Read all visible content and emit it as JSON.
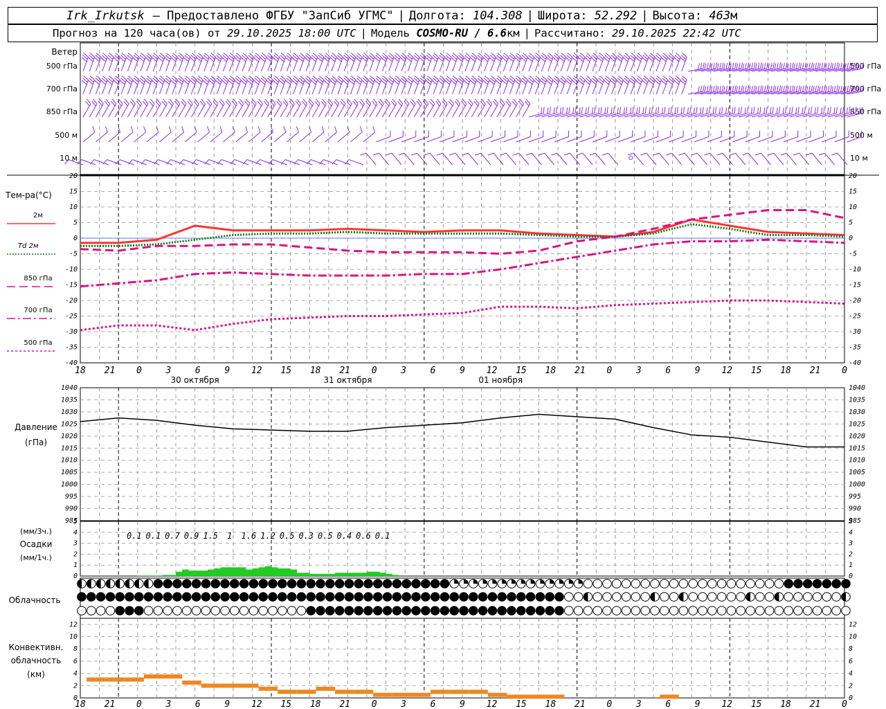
{
  "header": {
    "station": "Irk_Irkutsk",
    "provider": "— Предоставлено ФГБУ \"ЗапСиб УГМС\"",
    "lon_label": "Долгота:",
    "lon": "104.308",
    "lat_label": "Широта:",
    "lat": "52.292",
    "alt_label": "Высота:",
    "alt": "463",
    "alt_unit": "м",
    "forecast_label": "Прогноз на 120 часа(ов) от",
    "forecast_start": "29.10.2025 18:00 UTC",
    "model_label": "Модель",
    "model": "COSMO-RU / 6.6",
    "model_unit": "км",
    "calc_label": "Рассчитано:",
    "calc_time": "29.10.2025 22:42 UTC"
  },
  "wind_panel": {
    "title": "Ветер",
    "levels": [
      "500 гПа",
      "700 гПа",
      "850 гПа",
      "500 м",
      "10 м"
    ],
    "right_levels": [
      "500 гПа",
      "700 гПа",
      "850 гПа",
      "500 м",
      "10 м"
    ]
  },
  "temp_panel": {
    "title": "Тем-ра(°C)",
    "legend": [
      {
        "label": "2м",
        "color": "#ff3333",
        "style": "solid"
      },
      {
        "label": "Td 2м",
        "color": "#117711",
        "style": "dotted"
      },
      {
        "label": "850 гПа",
        "color": "#dd1188",
        "style": "dash"
      },
      {
        "label": "700 гПа",
        "color": "#dd1188",
        "style": "dashdot"
      },
      {
        "label": "500 гПа",
        "color": "#dd1188",
        "style": "dot"
      }
    ],
    "yticks": [
      "20",
      "15",
      "10",
      "5",
      "0",
      "-5",
      "-10",
      "-15",
      "-20",
      "-25",
      "-30",
      "-35",
      "-40"
    ]
  },
  "time_axis": {
    "hours": [
      "18",
      "21",
      "0",
      "3",
      "6",
      "9",
      "12",
      "15",
      "18",
      "21",
      "0",
      "3",
      "6",
      "9",
      "12",
      "15",
      "18",
      "21",
      "0",
      "3",
      "6",
      "9",
      "12",
      "15",
      "18",
      "21",
      "0"
    ],
    "dates": [
      "30 октября",
      "31 октября",
      "01 ноября"
    ]
  },
  "pressure_panel": {
    "title": "Давление",
    "unit": "(гПа)",
    "yticks": [
      "1040",
      "1035",
      "1030",
      "1025",
      "1020",
      "1015",
      "1010",
      "1005",
      "1000",
      "995",
      "990",
      "985"
    ]
  },
  "precip_panel": {
    "unit3h": "(мм/3ч.)",
    "title": "Осадки",
    "unit1h": "(мм/1ч.)",
    "yticks": [
      "5",
      "4",
      "3",
      "2",
      "1",
      "0"
    ],
    "totals": [
      "0.1",
      "0.1",
      "0.7",
      "0.9",
      "1.5",
      "1",
      "1.6",
      "1.2",
      "0.5",
      "0.3",
      "0.5",
      "0.4",
      "0.6",
      "0.1"
    ]
  },
  "cloud_panel": {
    "title": "Облачность"
  },
  "conv_panel": {
    "title1": "Конвективн.",
    "title2": "облачность",
    "unit": "(км)",
    "yticks": [
      "12",
      "10",
      "8",
      "6",
      "4",
      "2",
      "0"
    ]
  },
  "colors": {
    "wind": "#8a2be2",
    "t2m": "#ff3333",
    "td2m": "#117711",
    "upper": "#dd1188",
    "precip": "#22cc22",
    "conv": "#ee8822",
    "pressure": "#000000"
  },
  "chart_data": [
    {
      "type": "line",
      "title": "Тем-ра(°C)",
      "x": [
        0,
        6,
        12,
        18,
        24,
        30,
        36,
        42,
        48,
        54,
        60,
        66,
        72,
        78,
        84,
        90,
        96,
        102,
        108,
        114,
        120
      ],
      "ylim": [
        -40,
        20
      ],
      "series": [
        {
          "name": "2м",
          "values": [
            -1.5,
            -1.5,
            -0.5,
            4,
            2.5,
            2.5,
            2.5,
            3,
            2.5,
            2,
            2.5,
            2.5,
            1.5,
            1,
            0.5,
            2,
            6,
            4,
            2,
            1.5,
            1
          ]
        },
        {
          "name": "Td 2м",
          "values": [
            -2.5,
            -2.5,
            -2,
            -0.5,
            1,
            1.5,
            1.5,
            2,
            1.5,
            1.5,
            1.5,
            1.5,
            1,
            0.5,
            0.5,
            1.5,
            4.5,
            3,
            1,
            1,
            0.5
          ]
        },
        {
          "name": "850 гПа",
          "values": [
            -3.5,
            -4,
            -2.5,
            -2.5,
            -2,
            -2,
            -3,
            -4,
            -4.5,
            -4.5,
            -4.5,
            -5,
            -4,
            -1,
            0.5,
            3,
            6,
            7.5,
            9,
            9,
            6.5
          ]
        },
        {
          "name": "700 гПа",
          "values": [
            -15.5,
            -14.5,
            -13.5,
            -11.5,
            -11,
            -11.5,
            -12,
            -12,
            -12,
            -11.5,
            -11.5,
            -10,
            -8,
            -6,
            -4,
            -2,
            -1,
            -1,
            -0.5,
            -1,
            -1.5
          ]
        },
        {
          "name": "500 гПа",
          "values": [
            -29.5,
            -28,
            -28,
            -29.5,
            -27.5,
            -26,
            -25.5,
            -25,
            -25,
            -24.5,
            -24,
            -22,
            -22,
            -22.5,
            -21.5,
            -21,
            -20.5,
            -20,
            -20,
            -20.5,
            -21
          ]
        }
      ]
    },
    {
      "type": "line",
      "title": "Давление",
      "x": [
        0,
        6,
        12,
        18,
        24,
        30,
        36,
        42,
        48,
        54,
        60,
        66,
        72,
        78,
        84,
        90,
        96,
        102,
        108,
        114,
        120
      ],
      "ylim": [
        985,
        1040
      ],
      "series": [
        {
          "name": "",
          "values": [
            1026,
            1027.5,
            1026.5,
            1024.5,
            1023,
            1022.5,
            1022,
            1022,
            1023.5,
            1024.5,
            1025.5,
            1027.5,
            1029,
            1028,
            1027,
            1023.5,
            1020.5,
            1019.5,
            1017.5,
            1015.5,
            1015.5
          ]
        }
      ]
    },
    {
      "type": "bar",
      "title": "Осадки",
      "x_3h": [
        9,
        12,
        15,
        18,
        21,
        24,
        27,
        30,
        33,
        36,
        39,
        42,
        45,
        48
      ],
      "values_3h": [
        0.1,
        0.1,
        0.7,
        0.9,
        1.5,
        1,
        1.6,
        1.2,
        0.5,
        0.3,
        0.5,
        0.4,
        0.6,
        0.1
      ],
      "x_1h": [
        9,
        10,
        11,
        12,
        13,
        14,
        15,
        16,
        17,
        18,
        19,
        20,
        21,
        22,
        23,
        24,
        25,
        26,
        27,
        28,
        29,
        30,
        31,
        32,
        33,
        34,
        35,
        36,
        37,
        38,
        39,
        40,
        41,
        42,
        43,
        44,
        45,
        46,
        47,
        48,
        49
      ],
      "values_1h": [
        0.05,
        0.05,
        0.05,
        0.05,
        0.1,
        0.1,
        0.4,
        0.6,
        0.5,
        0.5,
        0.5,
        0.6,
        0.7,
        0.8,
        0.8,
        0.8,
        0.8,
        0.6,
        0.7,
        0.8,
        0.9,
        0.8,
        0.7,
        0.7,
        0.6,
        0.3,
        0.3,
        0.2,
        0.2,
        0.2,
        0.2,
        0.3,
        0.3,
        0.3,
        0.3,
        0.3,
        0.4,
        0.4,
        0.3,
        0.2,
        0.1
      ],
      "ylim": [
        0,
        5
      ]
    },
    {
      "type": "bar",
      "title": "Конвективн. облачность",
      "x": [
        0,
        3,
        6,
        9,
        12,
        15,
        18,
        21,
        24,
        27,
        30,
        33,
        36,
        39,
        42,
        45,
        48,
        51,
        54,
        57,
        60,
        63,
        66,
        69,
        72,
        90
      ],
      "values": [
        3,
        3,
        3,
        3.5,
        3.5,
        2.5,
        2,
        2,
        2,
        1.5,
        1,
        1,
        1.5,
        1,
        1,
        0.5,
        0.5,
        0.5,
        1,
        1,
        1,
        0.5,
        0.2,
        0.2,
        0.2,
        0.2
      ],
      "ylim": [
        0,
        13
      ]
    }
  ]
}
